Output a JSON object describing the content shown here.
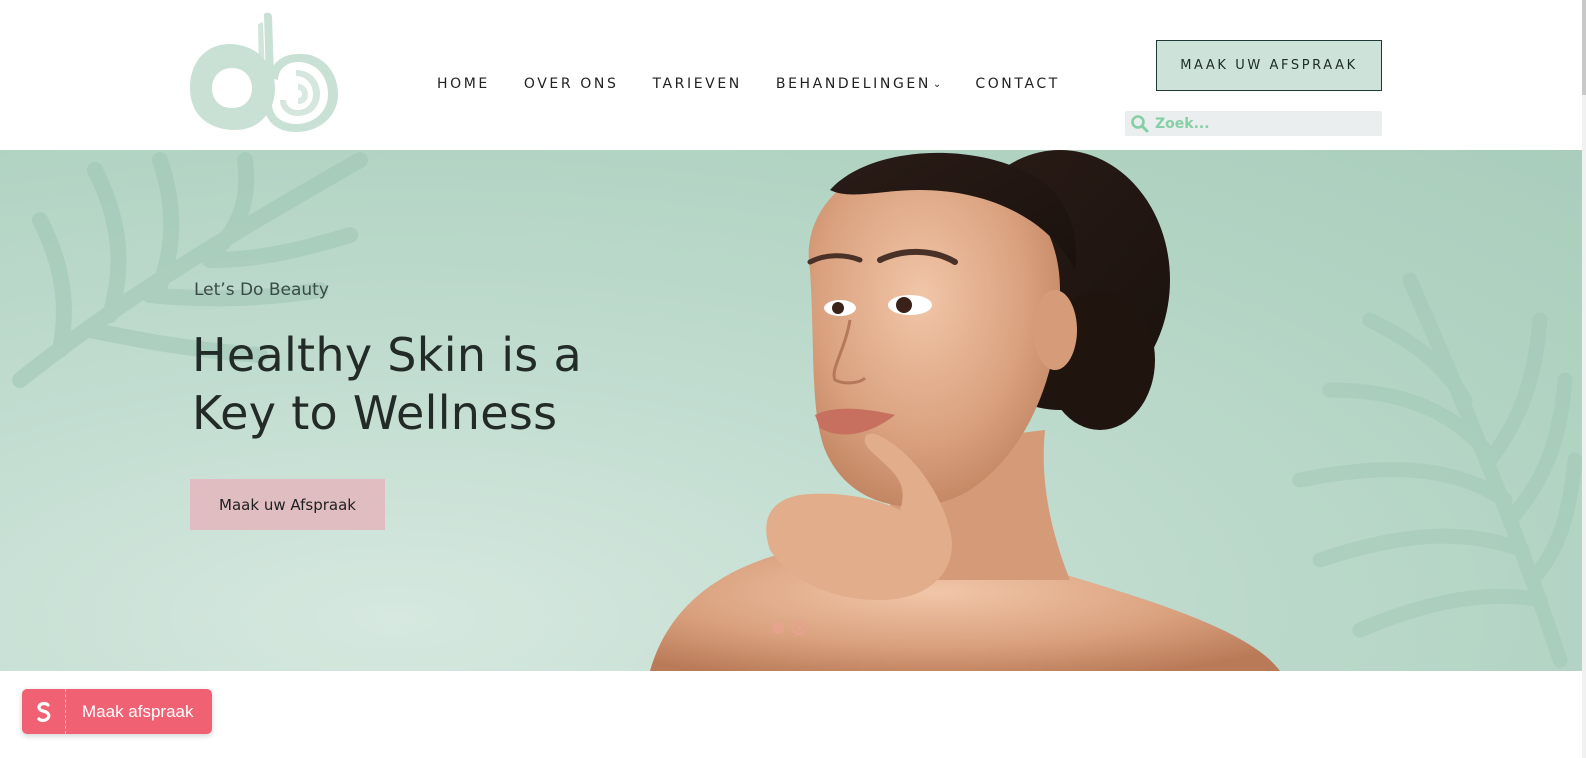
{
  "brand": {
    "logo_icon": "db-brushstroke-logo",
    "logo_color": "#c9e0d5"
  },
  "nav": {
    "items": [
      {
        "label": "HOME"
      },
      {
        "label": "OVER ONS"
      },
      {
        "label": "TARIEVEN"
      },
      {
        "label": "BEHANDELINGEN",
        "has_dropdown": true
      },
      {
        "label": "CONTACT"
      }
    ]
  },
  "header": {
    "cta_label": "MAAK UW AFSPRAAK",
    "search_placeholder": "Zoek...",
    "search_icon": "search-icon"
  },
  "hero": {
    "subtitle": "Let’s Do Beauty",
    "title": "Healthy Skin is a Key to Wellness",
    "button_label": "Maak uw Afspraak",
    "background_color": "#b8d8c8",
    "slides": {
      "count": 2,
      "active": 2
    }
  },
  "widget": {
    "label": "Maak afspraak",
    "icon": "salonized-s-icon",
    "color": "#f06273"
  },
  "colors": {
    "accent": "#cde2d9",
    "hero_button": "#dfbdc0",
    "slider_dot": "#e9a28f"
  }
}
